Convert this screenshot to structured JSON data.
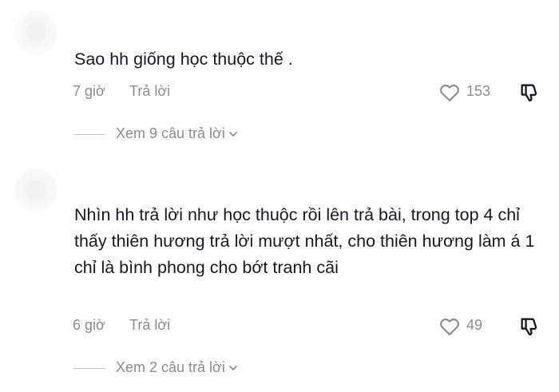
{
  "comments": [
    {
      "text": "Sao hh giống học thuộc thế .",
      "time": "7 giờ",
      "reply_label": "Trả lời",
      "likes": "153",
      "view_replies": "Xem 9 câu trả lời"
    },
    {
      "text": "Nhìn hh trả lời như học thuộc rồi lên trả bài, trong top 4 chỉ thấy thiên hương trả lời mượt nhất, cho thiên hương làm á 1 chỉ là bình phong cho bớt tranh cãi",
      "time": "6 giờ",
      "reply_label": "Trả lời",
      "likes": "49",
      "view_replies": "Xem 2 câu trả lời"
    }
  ],
  "icons": {
    "like": "heart-outline-icon",
    "dislike": "thumbs-down-icon",
    "expand": "chevron-down-icon"
  },
  "colors": {
    "text": "#161823",
    "muted": "#8a8b91",
    "divider": "#c4c4c6"
  }
}
